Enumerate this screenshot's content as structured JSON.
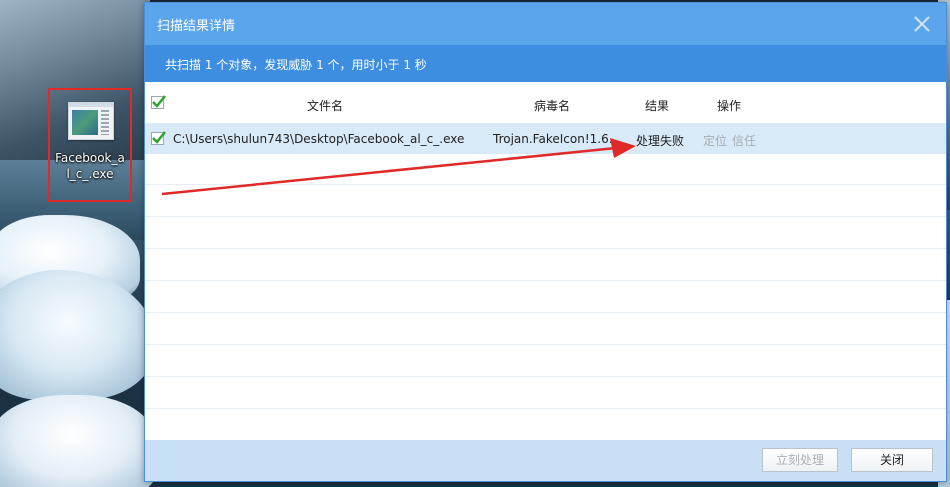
{
  "desktop": {
    "icon_label": "Facebook_al_c_.exe"
  },
  "dialog": {
    "title": "扫描结果详情",
    "summary": "共扫描 1 个对象，发现威胁 1 个，用时小于 1 秒",
    "columns": {
      "filename": "文件名",
      "virus": "病毒名",
      "result": "结果",
      "action": "操作"
    },
    "rows": [
      {
        "path": "C:\\Users\\shulun743\\Desktop\\Facebook_al_c_.exe",
        "virus": "Trojan.FakeIcon!1.6...",
        "result": "处理失败",
        "locate": "定位",
        "trust": "信任"
      }
    ],
    "buttons": {
      "process_now": "立刻处理",
      "close": "关闭"
    }
  },
  "colors": {
    "titlebar": "#5aa5ec",
    "summary_bar": "#3d8ee0",
    "selected_row": "#d8e9f8",
    "footer": "#c9dff5",
    "annotation_red": "#e02a2a",
    "check_green": "#2aa52a"
  }
}
